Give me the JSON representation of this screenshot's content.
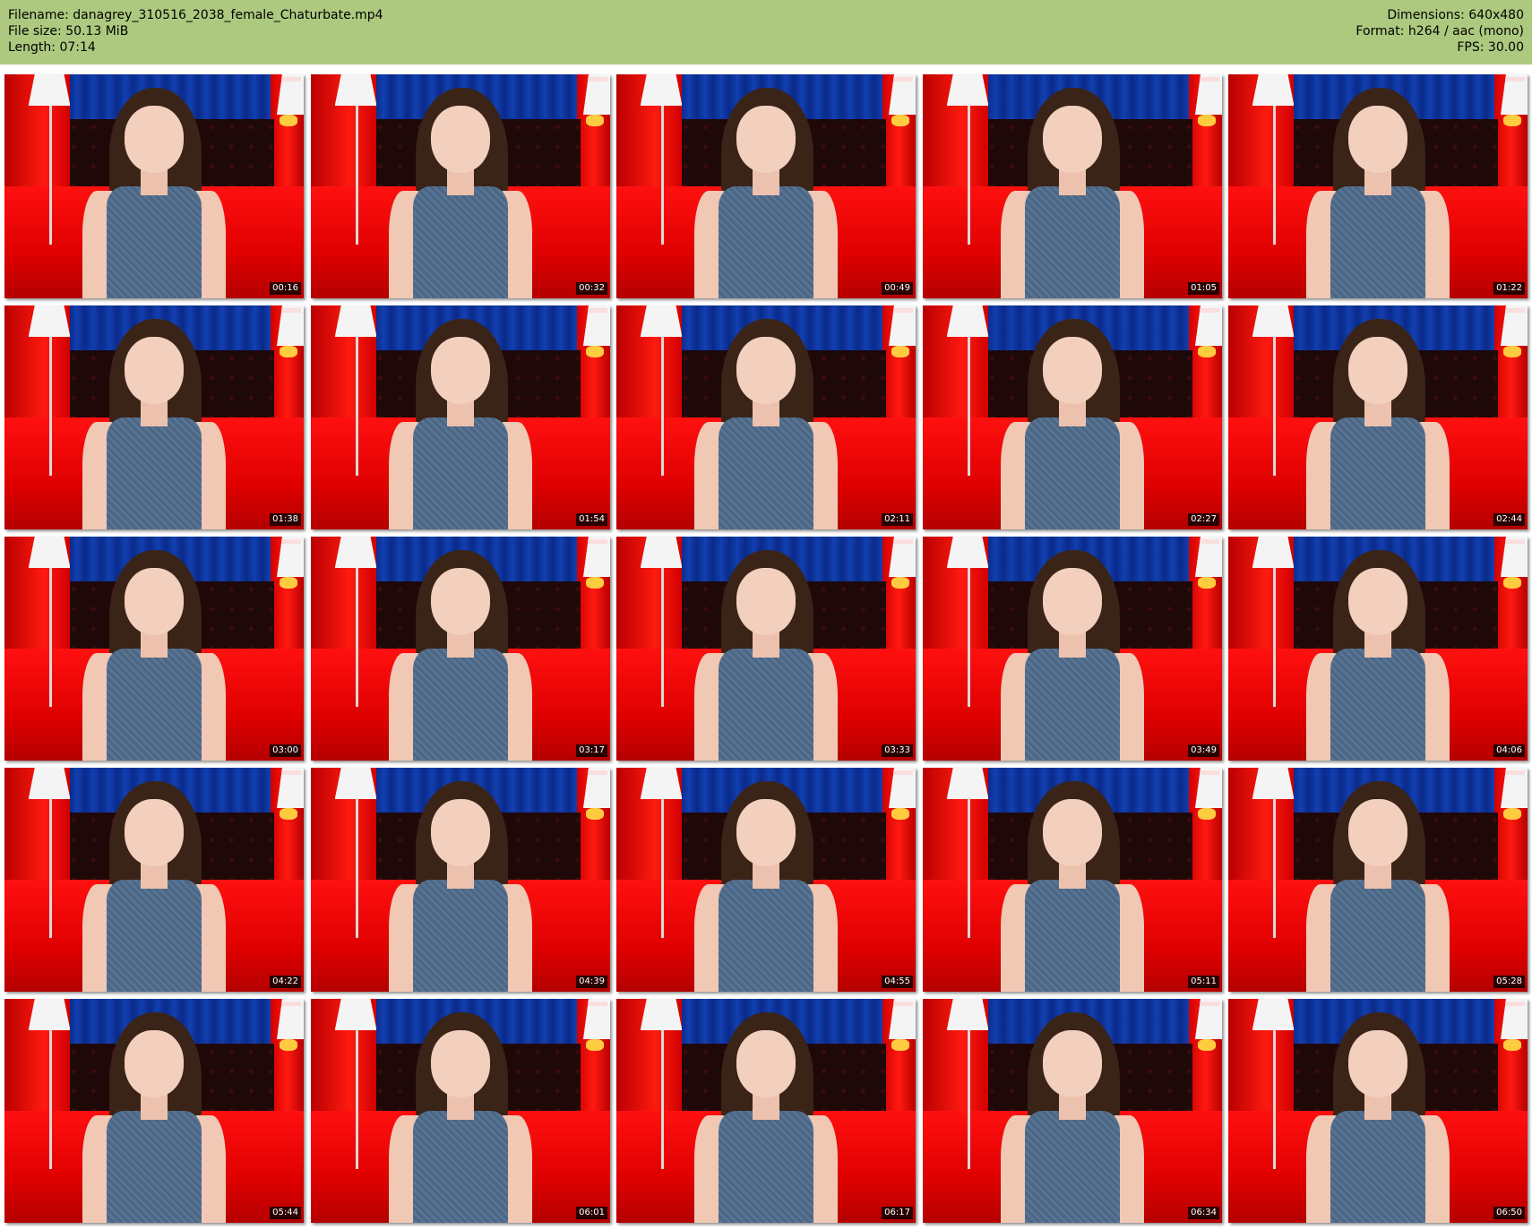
{
  "header": {
    "filename": "Filename: danagrey_310516_2038_female_Chaturbate.mp4",
    "filesize": "File size: 50.13 MiB",
    "length": "Length: 07:14",
    "dimensions": "Dimensions: 640x480",
    "format": "Format: h264 / aac (mono)",
    "fps": "FPS: 30.00"
  },
  "colors": {
    "header_bg": "#acc97f",
    "background": "#ffffff",
    "timestamp_bg": "#000000",
    "timestamp_text": "#ffffff"
  },
  "thumbnails": [
    {
      "time": "00:16"
    },
    {
      "time": "00:32"
    },
    {
      "time": "00:49"
    },
    {
      "time": "01:05"
    },
    {
      "time": "01:22"
    },
    {
      "time": "01:38"
    },
    {
      "time": "01:54"
    },
    {
      "time": "02:11"
    },
    {
      "time": "02:27"
    },
    {
      "time": "02:44"
    },
    {
      "time": "03:00"
    },
    {
      "time": "03:17"
    },
    {
      "time": "03:33"
    },
    {
      "time": "03:49"
    },
    {
      "time": "04:06"
    },
    {
      "time": "04:22"
    },
    {
      "time": "04:39"
    },
    {
      "time": "04:55"
    },
    {
      "time": "05:11"
    },
    {
      "time": "05:28"
    },
    {
      "time": "05:44"
    },
    {
      "time": "06:01"
    },
    {
      "time": "06:17"
    },
    {
      "time": "06:34"
    },
    {
      "time": "06:50"
    }
  ]
}
